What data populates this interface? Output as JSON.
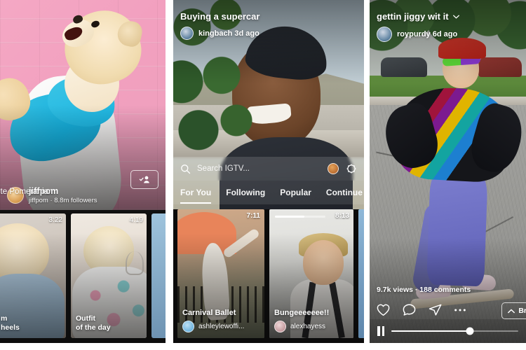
{
  "panels": {
    "profile": {
      "username": "jiffpom",
      "subtitle": "jiffpom · 8.8m followers",
      "description": "vorite Pomeranian",
      "follow_icon": "person-check-icon",
      "videos": [
        {
          "duration": "3:22",
          "title": "m\nheels"
        },
        {
          "duration": "4:19",
          "title": "Outfit\nof the day"
        }
      ]
    },
    "browse": {
      "header_title": "Buying a supercar",
      "header_user": "kingbach 3d ago",
      "search_placeholder": "Search IGTV...",
      "search_icon": "search-icon",
      "profile_icon": "mini-avatar-icon",
      "settings_icon": "settings-circle-icon",
      "tabs": [
        {
          "label": "For You",
          "active": true
        },
        {
          "label": "Following",
          "active": false
        },
        {
          "label": "Popular",
          "active": false
        },
        {
          "label": "Continue W",
          "active": false
        }
      ],
      "videos": [
        {
          "title": "Carnival Ballet",
          "user": "ashleylewoffi...",
          "duration": "7:11",
          "progress": 0
        },
        {
          "title": "Bungeeeeeee!!",
          "user": "alexhayess",
          "duration": "8:13",
          "progress": 58
        }
      ]
    },
    "player": {
      "title": "gettin jiggy wit it",
      "title_chevron_icon": "chevron-down-icon",
      "user": "roypurdy 6d ago",
      "stats": "9.7k views · 188 comments",
      "actions": [
        {
          "icon": "heart-icon"
        },
        {
          "icon": "comment-icon"
        },
        {
          "icon": "send-icon"
        },
        {
          "icon": "more-dots-icon"
        }
      ],
      "browse_label": "Br",
      "browse_icon": "chevron-up-icon",
      "pause_icon": "pause-icon",
      "progress_percent": 62
    }
  },
  "colors": {
    "accent_white": "#ffffff",
    "panel_bg": "#111111",
    "page_bg": "#ffffff",
    "brick_pink": "#f2a0bf",
    "shirt_blue": "#16b0dd"
  }
}
